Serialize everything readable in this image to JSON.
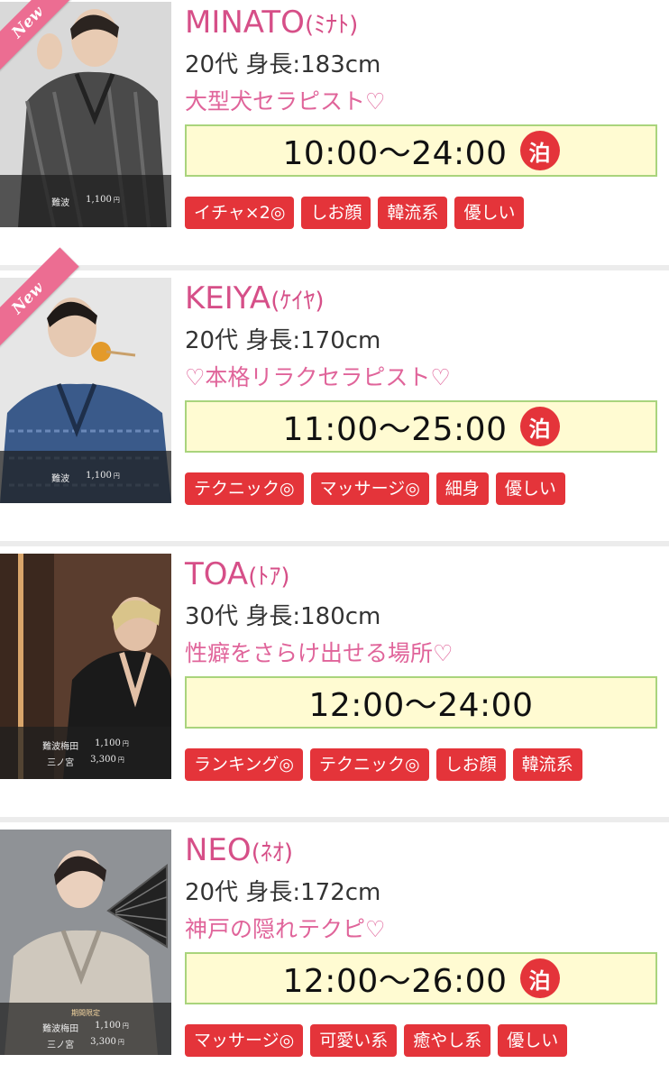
{
  "cast": [
    {
      "name": "MINATO",
      "kana": "(ﾐﾅﾄ)",
      "is_new": true,
      "new_label": "New",
      "age_height": "20代 身長:183cm",
      "catchphrase": "大型犬セラピスト♡",
      "schedule": "10:00〜24:00",
      "overnight": true,
      "overnight_label": "泊",
      "prices": [
        {
          "area": "難波",
          "price": "1,100",
          "unit": "円"
        }
      ],
      "limited_label": "",
      "tags": [
        "イチャ×2◎",
        "しお顔",
        "韓流系",
        "優しい"
      ],
      "photo_bg": "#d9d9d9",
      "kimono_color": "#4a4a4a"
    },
    {
      "name": "KEIYA",
      "kana": "(ｹｲﾔ)",
      "is_new": true,
      "new_label": "New",
      "age_height": "20代 身長:170cm",
      "catchphrase": "♡本格リラクセラピスト♡",
      "schedule": "11:00〜25:00",
      "overnight": true,
      "overnight_label": "泊",
      "prices": [
        {
          "area": "難波",
          "price": "1,100",
          "unit": "円"
        }
      ],
      "limited_label": "",
      "tags": [
        "テクニック◎",
        "マッサージ◎",
        "細身",
        "優しい"
      ],
      "photo_bg": "#e6e6e6",
      "kimono_color": "#3a5a8a"
    },
    {
      "name": "TOA",
      "kana": "(ﾄｱ)",
      "is_new": false,
      "new_label": "",
      "age_height": "30代 身長:180cm",
      "catchphrase": "性癖をさらけ出せる場所♡",
      "schedule": "12:00〜24:00",
      "overnight": false,
      "overnight_label": "",
      "prices": [
        {
          "area": "難波梅田",
          "price": "1,100",
          "unit": "円"
        },
        {
          "area": "三ノ宮",
          "price": "3,300",
          "unit": "円"
        }
      ],
      "limited_label": "",
      "tags": [
        "ランキング◎",
        "テクニック◎",
        "しお顔",
        "韓流系"
      ],
      "photo_bg": "#5a3d2e",
      "kimono_color": "#1a1a1a"
    },
    {
      "name": "NEO",
      "kana": "(ﾈｵ)",
      "is_new": false,
      "new_label": "",
      "age_height": "20代 身長:172cm",
      "catchphrase": "神戸の隠れテクピ♡",
      "schedule": "12:00〜26:00",
      "overnight": true,
      "overnight_label": "泊",
      "prices": [
        {
          "area": "難波梅田",
          "price": "1,100",
          "unit": "円"
        },
        {
          "area": "三ノ宮",
          "price": "3,300",
          "unit": "円"
        }
      ],
      "limited_label": "期間限定",
      "tags": [
        "マッサージ◎",
        "可愛い系",
        "癒やし系",
        "優しい"
      ],
      "photo_bg": "#8f9296",
      "kimono_color": "#cfc8bd"
    }
  ]
}
